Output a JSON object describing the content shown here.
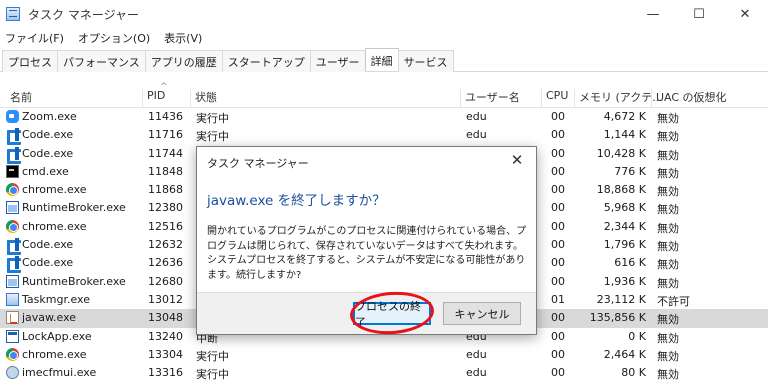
{
  "window": {
    "title": "タスク マネージャー",
    "minimize_glyph": "—",
    "maximize_glyph": "☐",
    "close_glyph": "✕"
  },
  "menu": [
    "ファイル(F)",
    "オプション(O)",
    "表示(V)"
  ],
  "tabs": [
    {
      "label": "プロセス",
      "active": false
    },
    {
      "label": "パフォーマンス",
      "active": false
    },
    {
      "label": "アプリの履歴",
      "active": false
    },
    {
      "label": "スタートアップ",
      "active": false
    },
    {
      "label": "ユーザー",
      "active": false
    },
    {
      "label": "詳細",
      "active": true
    },
    {
      "label": "サービス",
      "active": false
    }
  ],
  "table": {
    "sort_indicator": "^",
    "columns": {
      "name": "名前",
      "pid": "PID",
      "status": "状態",
      "user": "ユーザー名",
      "cpu": "CPU",
      "memory": "メモリ (アクテ...",
      "uac": "UAC の仮想化"
    },
    "rows": [
      {
        "icon": "zoom-icon",
        "name": "Zoom.exe",
        "pid": "11436",
        "status": "実行中",
        "user": "edu",
        "cpu": "00",
        "memory": "4,672 K",
        "uac": "無効",
        "selected": false
      },
      {
        "icon": "vscode-icon",
        "name": "Code.exe",
        "pid": "11716",
        "status": "実行中",
        "user": "edu",
        "cpu": "00",
        "memory": "1,144 K",
        "uac": "無効",
        "selected": false
      },
      {
        "icon": "vscode-icon",
        "name": "Code.exe",
        "pid": "11744",
        "status": "",
        "user": "",
        "cpu": "00",
        "memory": "10,428 K",
        "uac": "無効",
        "selected": false
      },
      {
        "icon": "cmd-icon",
        "name": "cmd.exe",
        "pid": "11848",
        "status": "",
        "user": "",
        "cpu": "00",
        "memory": "776 K",
        "uac": "無効",
        "selected": false
      },
      {
        "icon": "chrome-icon",
        "name": "chrome.exe",
        "pid": "11868",
        "status": "",
        "user": "",
        "cpu": "00",
        "memory": "18,868 K",
        "uac": "無効",
        "selected": false
      },
      {
        "icon": "runtime-broker-icon",
        "name": "RuntimeBroker.exe",
        "pid": "12380",
        "status": "",
        "user": "",
        "cpu": "00",
        "memory": "5,968 K",
        "uac": "無効",
        "selected": false
      },
      {
        "icon": "chrome-icon",
        "name": "chrome.exe",
        "pid": "12516",
        "status": "",
        "user": "",
        "cpu": "00",
        "memory": "2,344 K",
        "uac": "無効",
        "selected": false
      },
      {
        "icon": "vscode-icon",
        "name": "Code.exe",
        "pid": "12632",
        "status": "",
        "user": "",
        "cpu": "00",
        "memory": "1,796 K",
        "uac": "無効",
        "selected": false
      },
      {
        "icon": "vscode-icon",
        "name": "Code.exe",
        "pid": "12636",
        "status": "",
        "user": "",
        "cpu": "00",
        "memory": "616 K",
        "uac": "無効",
        "selected": false
      },
      {
        "icon": "runtime-broker-icon",
        "name": "RuntimeBroker.exe",
        "pid": "12680",
        "status": "",
        "user": "",
        "cpu": "00",
        "memory": "1,936 K",
        "uac": "無効",
        "selected": false
      },
      {
        "icon": "taskmgr-icon",
        "name": "Taskmgr.exe",
        "pid": "13012",
        "status": "",
        "user": "",
        "cpu": "01",
        "memory": "23,112 K",
        "uac": "不許可",
        "selected": false
      },
      {
        "icon": "java-icon",
        "name": "javaw.exe",
        "pid": "13048",
        "status": "",
        "user": "",
        "cpu": "00",
        "memory": "135,856 K",
        "uac": "無効",
        "selected": true
      },
      {
        "icon": "lockapp-icon",
        "name": "LockApp.exe",
        "pid": "13240",
        "status": "中断",
        "user": "edu",
        "cpu": "00",
        "memory": "0 K",
        "uac": "無効",
        "selected": false
      },
      {
        "icon": "chrome-icon",
        "name": "chrome.exe",
        "pid": "13304",
        "status": "実行中",
        "user": "edu",
        "cpu": "00",
        "memory": "2,464 K",
        "uac": "無効",
        "selected": false
      },
      {
        "icon": "ime-icon",
        "name": "imecfmui.exe",
        "pid": "13316",
        "status": "実行中",
        "user": "edu",
        "cpu": "00",
        "memory": "80 K",
        "uac": "無効",
        "selected": false
      }
    ]
  },
  "dialog": {
    "title": "タスク マネージャー",
    "close_glyph": "✕",
    "heading": "javaw.exe を終了しますか？",
    "body": "開かれているプログラムがこのプロセスに関連付けられている場合、プログラムは閉じられて、保存されていないデータはすべて失われます。システムプロセスを終了すると、システムが不安定になる可能性があります。続行しますか?",
    "confirm_label": "プロセスの終了",
    "cancel_label": "キャンセル"
  },
  "annotation": {
    "color": "#e8121a"
  }
}
